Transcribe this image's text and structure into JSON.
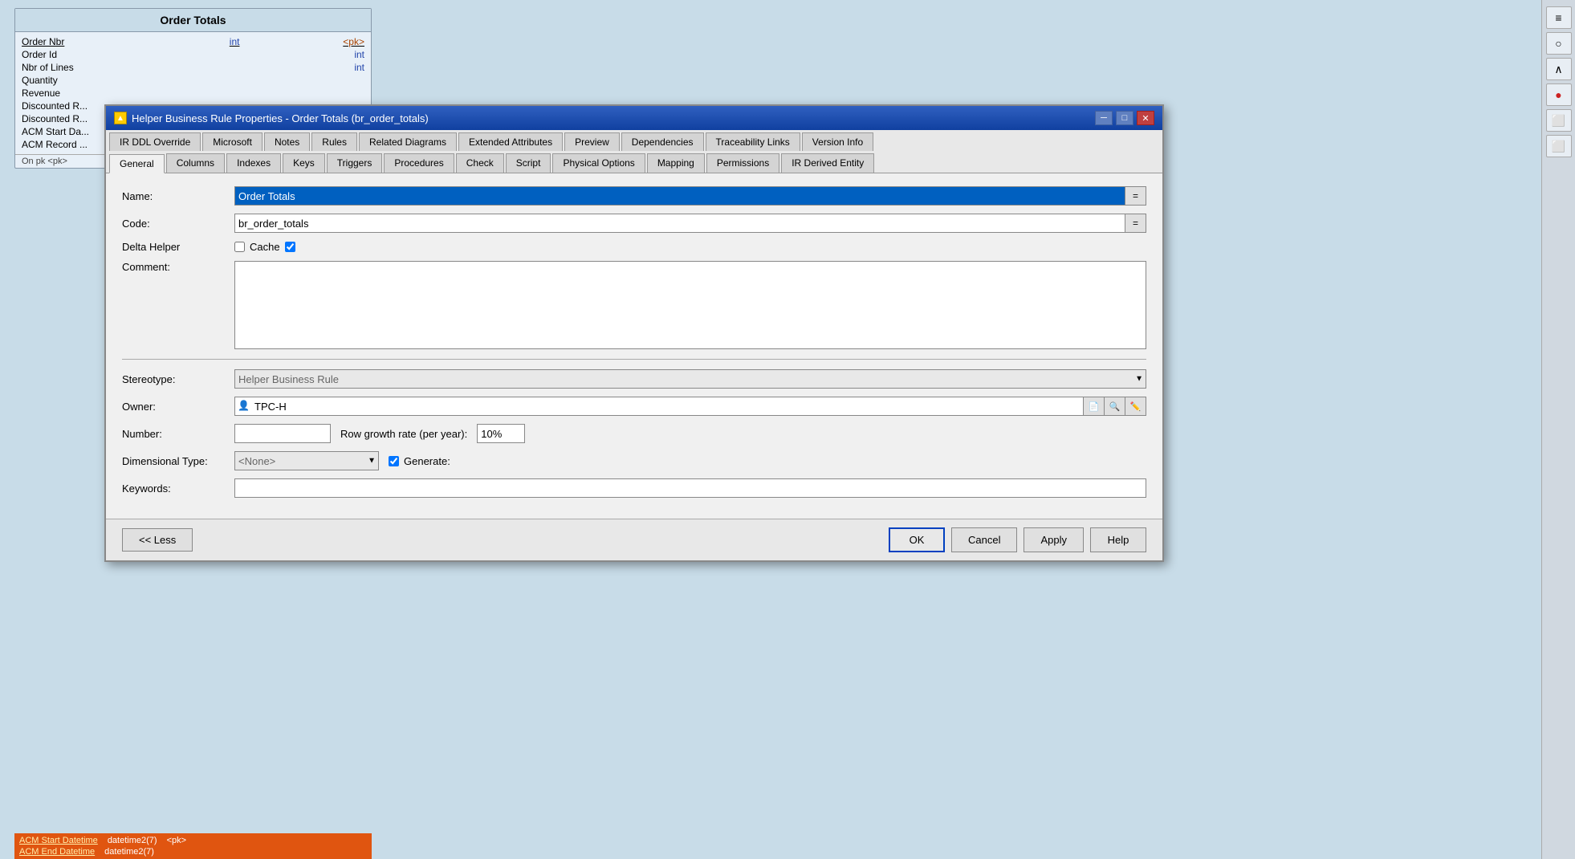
{
  "canvas": {
    "entity": {
      "title": "Order Totals",
      "rows": [
        {
          "name": "Order Nbr",
          "type": "int",
          "pk": "<pk>",
          "underline": true
        },
        {
          "name": "Order Id",
          "type": "int",
          "pk": ""
        },
        {
          "name": "Nbr of Lines",
          "type": "int",
          "pk": ""
        },
        {
          "name": "Quantity",
          "type": "",
          "pk": ""
        },
        {
          "name": "Revenue",
          "type": "",
          "pk": ""
        },
        {
          "name": "Discounted R...",
          "type": "",
          "pk": ""
        },
        {
          "name": "Discounted R...",
          "type": "",
          "pk": ""
        },
        {
          "name": "ACM Start Da...",
          "type": "",
          "pk": ""
        },
        {
          "name": "ACM Record ...",
          "type": "",
          "pk": ""
        }
      ],
      "footer_label": "On pk <pk>"
    }
  },
  "dialog": {
    "title": "Helper Business Rule Properties - Order Totals (br_order_totals)",
    "tabs_row1": [
      {
        "label": "IR DDL Override",
        "active": false
      },
      {
        "label": "Microsoft",
        "active": false
      },
      {
        "label": "Notes",
        "active": false
      },
      {
        "label": "Rules",
        "active": false
      },
      {
        "label": "Related Diagrams",
        "active": false
      },
      {
        "label": "Extended Attributes",
        "active": false
      },
      {
        "label": "Preview",
        "active": false
      },
      {
        "label": "Dependencies",
        "active": false
      },
      {
        "label": "Traceability Links",
        "active": false
      },
      {
        "label": "Version Info",
        "active": false
      }
    ],
    "tabs_row2": [
      {
        "label": "General",
        "active": true
      },
      {
        "label": "Columns",
        "active": false
      },
      {
        "label": "Indexes",
        "active": false
      },
      {
        "label": "Keys",
        "active": false
      },
      {
        "label": "Triggers",
        "active": false
      },
      {
        "label": "Procedures",
        "active": false
      },
      {
        "label": "Check",
        "active": false
      },
      {
        "label": "Script",
        "active": false
      },
      {
        "label": "Physical Options",
        "active": false
      },
      {
        "label": "Mapping",
        "active": false
      },
      {
        "label": "Permissions",
        "active": false
      },
      {
        "label": "IR Derived Entity",
        "active": false
      }
    ],
    "form": {
      "name_label": "Name:",
      "name_value": "Order Totals",
      "code_label": "Code:",
      "code_value": "br_order_totals",
      "delta_helper_label": "Delta Helper",
      "delta_helper_checked": false,
      "cache_label": "Cache",
      "cache_checked": true,
      "comment_label": "Comment:",
      "comment_value": "",
      "stereotype_label": "Stereotype:",
      "stereotype_value": "Helper Business Rule",
      "stereotype_placeholder": "Helper Business Rule",
      "owner_label": "Owner:",
      "owner_value": "TPC-H",
      "number_label": "Number:",
      "number_value": "",
      "row_growth_label": "Row growth rate (per year):",
      "row_growth_value": "10%",
      "dimensional_type_label": "Dimensional Type:",
      "dimensional_type_value": "<None>",
      "generate_label": "Generate:",
      "generate_checked": true,
      "keywords_label": "Keywords:",
      "keywords_value": ""
    },
    "footer": {
      "less_btn": "<< Less",
      "ok_btn": "OK",
      "cancel_btn": "Cancel",
      "apply_btn": "Apply",
      "help_btn": "Help"
    }
  },
  "bottom_acm": {
    "rows": [
      {
        "label": "ACM Start Datetime",
        "type": "datetime2(7)",
        "pk": "<pk>"
      },
      {
        "label": "ACM End Datetime",
        "type": "datetime2(7)",
        "pk": ""
      }
    ]
  }
}
